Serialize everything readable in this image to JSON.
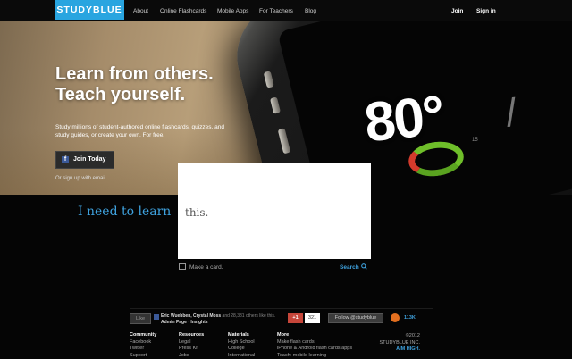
{
  "header": {
    "logo": "STUDYBLUE",
    "nav": [
      "About",
      "Online Flashcards",
      "Mobile Apps",
      "For Teachers",
      "Blog"
    ],
    "join": "Join",
    "signin": "Sign in"
  },
  "hero": {
    "headline_1": "Learn from others.",
    "headline_2": "Teach yourself.",
    "subtext": "Study millions of student-authored online flashcards, quizzes, and study guides, or create your own. For free.",
    "join_button": "Join Today",
    "fb_letter": "f",
    "signup_email": "Or sign up with email",
    "phone_temp": "80°",
    "phone_temp_side": "/",
    "phone_small": "15"
  },
  "search": {
    "prompt": "I need to learn",
    "card_text": "this.",
    "make_card": "Make a card.",
    "search_link": "Search"
  },
  "social": {
    "like": "Like",
    "names": "Eric Wuebben, Crystal Moss",
    "others": " and 28,381 others like this.",
    "admin_page": "Admin Page",
    "insights": "Insights",
    "gplus": "+1",
    "gplus_count": "321",
    "follow": "Follow @studyblue",
    "rss_count": "113K"
  },
  "footer": {
    "columns": [
      {
        "heading": "Community",
        "links": [
          "Facebook",
          "Twitter",
          "Support"
        ]
      },
      {
        "heading": "Resources",
        "links": [
          "Legal",
          "Press Kit",
          "Jobs"
        ]
      },
      {
        "heading": "Materials",
        "links": [
          "High School",
          "College",
          "International"
        ]
      },
      {
        "heading": "More",
        "links": [
          "Make flash cards",
          "iPhone & Android flash cards apps",
          "Teach: mobile learning"
        ]
      }
    ],
    "copyright": "©2012",
    "company": "STUDYBLUE INC.",
    "tagline": "AIM HIGH."
  },
  "colors": {
    "brand_blue": "#29a5e0",
    "accent_blue": "#3fa3e0",
    "facebook": "#3b5998",
    "gplus": "#c6463a",
    "rss": "#e36f1f"
  }
}
